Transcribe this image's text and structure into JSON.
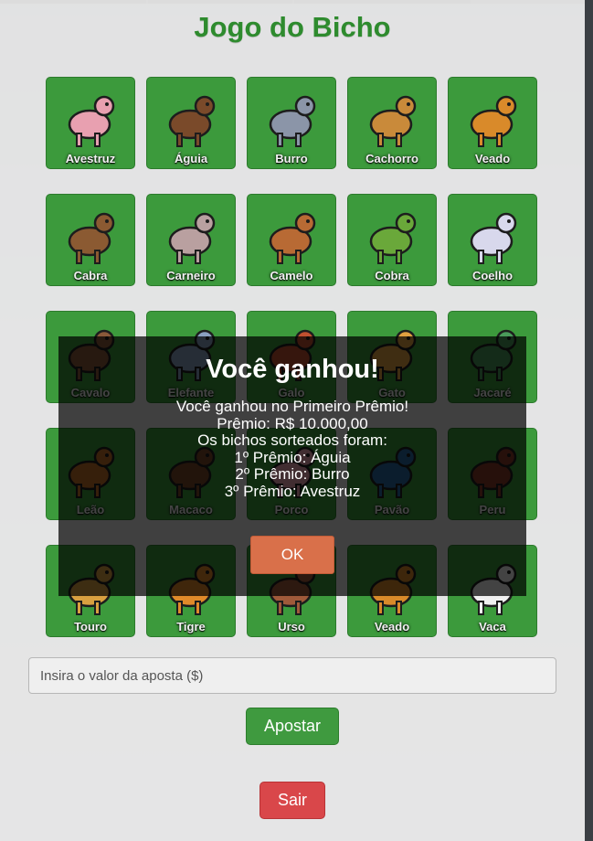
{
  "title": "Jogo do Bicho",
  "animals": [
    {
      "label": "Avestruz",
      "icon": "ostrich-icon",
      "color": "#e8a0b0"
    },
    {
      "label": "Águia",
      "icon": "eagle-icon",
      "color": "#7a4a2a"
    },
    {
      "label": "Burro",
      "icon": "donkey-icon",
      "color": "#8b95a8"
    },
    {
      "label": "Cachorro",
      "icon": "dog-icon",
      "color": "#c98a3a"
    },
    {
      "label": "Veado",
      "icon": "deer-icon",
      "color": "#d98a2a"
    },
    {
      "label": "Cabra",
      "icon": "goat-icon",
      "color": "#8b5a32"
    },
    {
      "label": "Carneiro",
      "icon": "ram-icon",
      "color": "#b9a0a0"
    },
    {
      "label": "Camelo",
      "icon": "camel-icon",
      "color": "#b86a34"
    },
    {
      "label": "Cobra",
      "icon": "snake-icon",
      "color": "#6aa83a"
    },
    {
      "label": "Coelho",
      "icon": "rabbit-icon",
      "color": "#d8d8ec"
    },
    {
      "label": "Cavalo",
      "icon": "horse-icon",
      "color": "#8b5a3a"
    },
    {
      "label": "Elefante",
      "icon": "elephant-icon",
      "color": "#8aa0c0"
    },
    {
      "label": "Galo",
      "icon": "rooster-icon",
      "color": "#c05030"
    },
    {
      "label": "Gato",
      "icon": "cat-icon",
      "color": "#e0a040"
    },
    {
      "label": "Jacaré",
      "icon": "alligator-icon",
      "color": "#4a9a5a"
    },
    {
      "label": "Leão",
      "icon": "lion-icon",
      "color": "#c0702a"
    },
    {
      "label": "Macaco",
      "icon": "monkey-icon",
      "color": "#7a4a2a"
    },
    {
      "label": "Porco",
      "icon": "pig-icon",
      "color": "#e8a0b0"
    },
    {
      "label": "Pavão",
      "icon": "peacock-icon",
      "color": "#2a6aa0"
    },
    {
      "label": "Peru",
      "icon": "turkey-icon",
      "color": "#8a3a2a"
    },
    {
      "label": "Touro",
      "icon": "bull-icon",
      "color": "#d9a040"
    },
    {
      "label": "Tigre",
      "icon": "tiger-icon",
      "color": "#e08a2a"
    },
    {
      "label": "Urso",
      "icon": "bear-icon",
      "color": "#a05a3a"
    },
    {
      "label": "Veado",
      "icon": "deer-icon",
      "color": "#d98a2a"
    },
    {
      "label": "Vaca",
      "icon": "cow-icon",
      "color": "#f0f0f0"
    }
  ],
  "bet": {
    "placeholder": "Insira o valor da aposta ($)"
  },
  "buttons": {
    "bet_label": "Apostar",
    "exit_label": "Sair"
  },
  "modal": {
    "title": "Você ganhou!",
    "lines": [
      "Você ganhou no Primeiro Prêmio!",
      "Prêmio: R$ 10.000,00",
      "Os bichos sorteados foram:",
      "1º Prêmio: Águia",
      "2º Prêmio: Burro",
      "3º Prêmio: Avestruz"
    ],
    "ok_label": "OK"
  },
  "colors": {
    "card": "#3c9a3c",
    "title": "#2e8b2e",
    "ok": "#d9704a",
    "exit": "#d9474a"
  }
}
